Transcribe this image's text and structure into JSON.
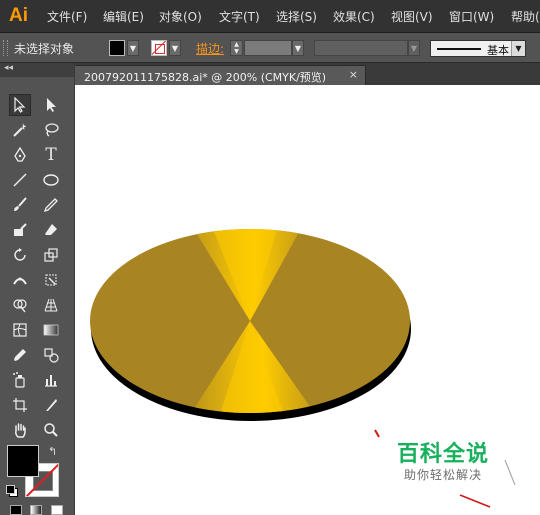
{
  "app": {
    "logo": "Ai"
  },
  "menu": [
    "文件(F)",
    "编辑(E)",
    "对象(O)",
    "文字(T)",
    "选择(S)",
    "效果(C)",
    "视图(V)",
    "窗口(W)",
    "帮助("
  ],
  "control_bar": {
    "selection_label": "未选择对象",
    "stroke_label": "描边:",
    "stroke_profile": "基本"
  },
  "document_tab": {
    "title": "20079201117582­8.ai* @ 200% (CMYK/预览)",
    "close": "×"
  },
  "toolbox": {
    "collapse": "◂◂",
    "tools": [
      "selection-tool",
      "direct-selection-tool",
      "magic-wand-tool",
      "lasso-tool",
      "pen-tool",
      "type-tool",
      "line-segment-tool",
      "ellipse-tool",
      "paintbrush-tool",
      "pencil-tool",
      "blob-brush-tool",
      "eraser-tool",
      "rotate-tool",
      "scale-tool",
      "width-tool",
      "free-transform-tool",
      "shape-builder-tool",
      "perspective-grid-tool",
      "mesh-tool",
      "gradient-tool",
      "eyedropper-tool",
      "blend-tool",
      "symbol-sprayer-tool",
      "column-graph-tool",
      "artboard-tool",
      "slice-tool",
      "hand-tool",
      "zoom-tool"
    ]
  },
  "colors": {
    "accent": "#ff9a00",
    "gold_dark": "#a88423",
    "gold_light": "#ffcc00",
    "watermark_green": "#17b15c"
  },
  "watermark": {
    "title": "百科全说",
    "subtitle": "助你轻松解决"
  }
}
